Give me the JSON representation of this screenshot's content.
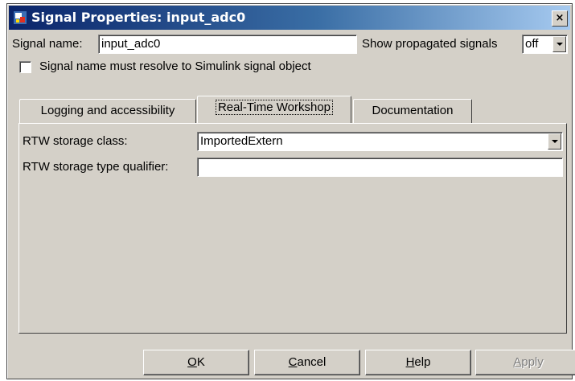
{
  "window": {
    "title": "Signal Properties: input_adc0",
    "close_glyph": "×"
  },
  "signal_name": {
    "label": "Signal name:",
    "value": "input_adc0"
  },
  "show_propagated": {
    "label": "Show propagated signals",
    "value": "off"
  },
  "resolve_checkbox": {
    "label": "Signal name must resolve to Simulink signal object",
    "checked": false
  },
  "tabs": [
    {
      "label": "Logging and accessibility",
      "active": false
    },
    {
      "label": "Real-Time Workshop",
      "active": true
    },
    {
      "label": "Documentation",
      "active": false
    }
  ],
  "rtw": {
    "storage_class_label": "RTW storage class:",
    "storage_class_value": "ImportedExtern",
    "type_qualifier_label": "RTW storage type qualifier:",
    "type_qualifier_value": ""
  },
  "buttons": {
    "ok": {
      "mnemonic": "O",
      "rest": "K"
    },
    "cancel": {
      "mnemonic": "C",
      "rest": "ancel"
    },
    "help": {
      "mnemonic": "H",
      "rest": "elp"
    },
    "apply": {
      "mnemonic": "A",
      "rest": "pply",
      "enabled": false
    }
  },
  "icons": {
    "app": "simulink-block-icon",
    "close": "close-icon",
    "dropdown": "chevron-down-icon"
  }
}
